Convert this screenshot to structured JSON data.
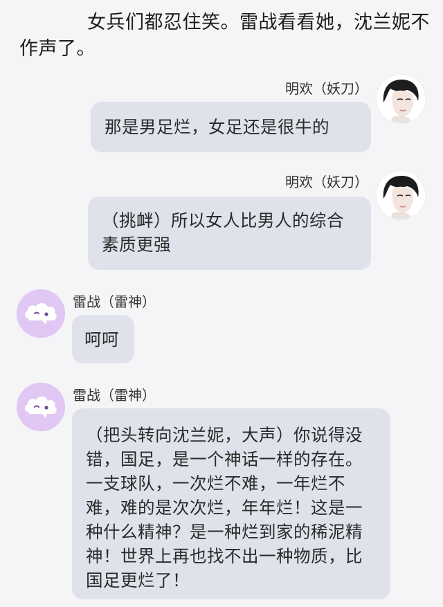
{
  "narration": "女兵们都忍住笑。雷战看看她，沈兰妮不作声了。",
  "messages": [
    {
      "sender": "明欢（妖刀）",
      "side": "right",
      "avatar": "girl-photo-avatar",
      "text": "那是男足烂，女足还是很牛的"
    },
    {
      "sender": "明欢（妖刀）",
      "side": "right",
      "avatar": "girl-photo-avatar",
      "text": "（挑衅）所以女人比男人的综合素质更强"
    },
    {
      "sender": "雷战（雷神）",
      "side": "left",
      "avatar": "cloud-face-icon",
      "text": "呵呵"
    },
    {
      "sender": "雷战（雷神）",
      "side": "left",
      "avatar": "cloud-face-icon",
      "text": "（把头转向沈兰妮，大声）你说得没错，国足，是一个神话一样的存在。一支球队，一次烂不难，一年烂不难，难的是次次烂，年年烂！这是一种什么精神？是一种烂到家的稀泥精神！世界上再也找不出一种物质，比国足更烂了！"
    }
  ],
  "colors": {
    "background": "#f5f5f7",
    "bubble": "#dfe2ea",
    "cloud_avatar_bg": "#e0c7f4",
    "cloud_eye": "#6b4a9a"
  }
}
